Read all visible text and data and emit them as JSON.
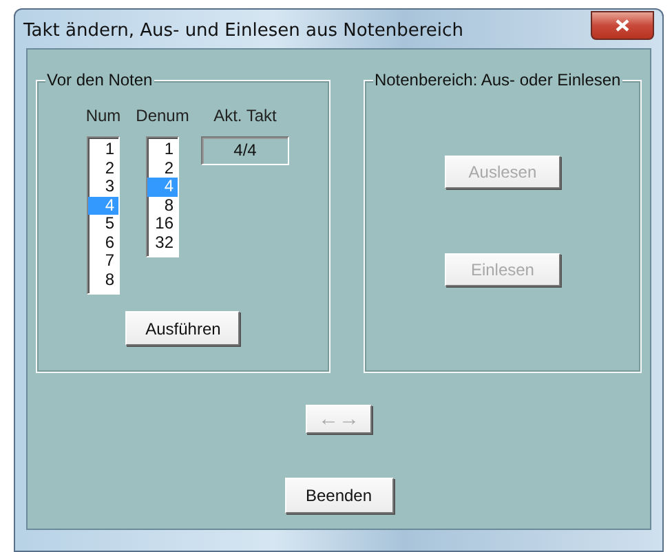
{
  "window": {
    "title": "Takt ändern,  Aus- und Einlesen aus Notenbereich"
  },
  "left_group": {
    "legend": "Vor den Noten",
    "lists": [
      {
        "header": "Num",
        "items": [
          {
            "label": "1",
            "selected": false
          },
          {
            "label": "2",
            "selected": false
          },
          {
            "label": "3",
            "selected": false
          },
          {
            "label": "4",
            "selected": true
          },
          {
            "label": "5",
            "selected": false
          },
          {
            "label": "6",
            "selected": false
          },
          {
            "label": "7",
            "selected": false
          },
          {
            "label": "8",
            "selected": false
          }
        ]
      },
      {
        "header": "Denum",
        "items": [
          {
            "label": "1",
            "selected": false
          },
          {
            "label": "2",
            "selected": false
          },
          {
            "label": "4",
            "selected": true
          },
          {
            "label": "8",
            "selected": false
          },
          {
            "label": "16",
            "selected": false
          },
          {
            "label": "32",
            "selected": false
          }
        ]
      }
    ],
    "current": {
      "label": "Akt. Takt",
      "value": "4/4"
    },
    "button": {
      "label": "Ausführen",
      "disabled": false
    }
  },
  "right_group": {
    "legend": "Notenbereich: Aus- oder Einlesen",
    "buttons": [
      {
        "label": "Auslesen",
        "disabled": true
      },
      {
        "label": "Einlesen",
        "disabled": true
      }
    ]
  },
  "swap_button": {
    "label": "←→",
    "disabled": true
  },
  "close_button": {
    "label": "Beenden",
    "disabled": false
  }
}
